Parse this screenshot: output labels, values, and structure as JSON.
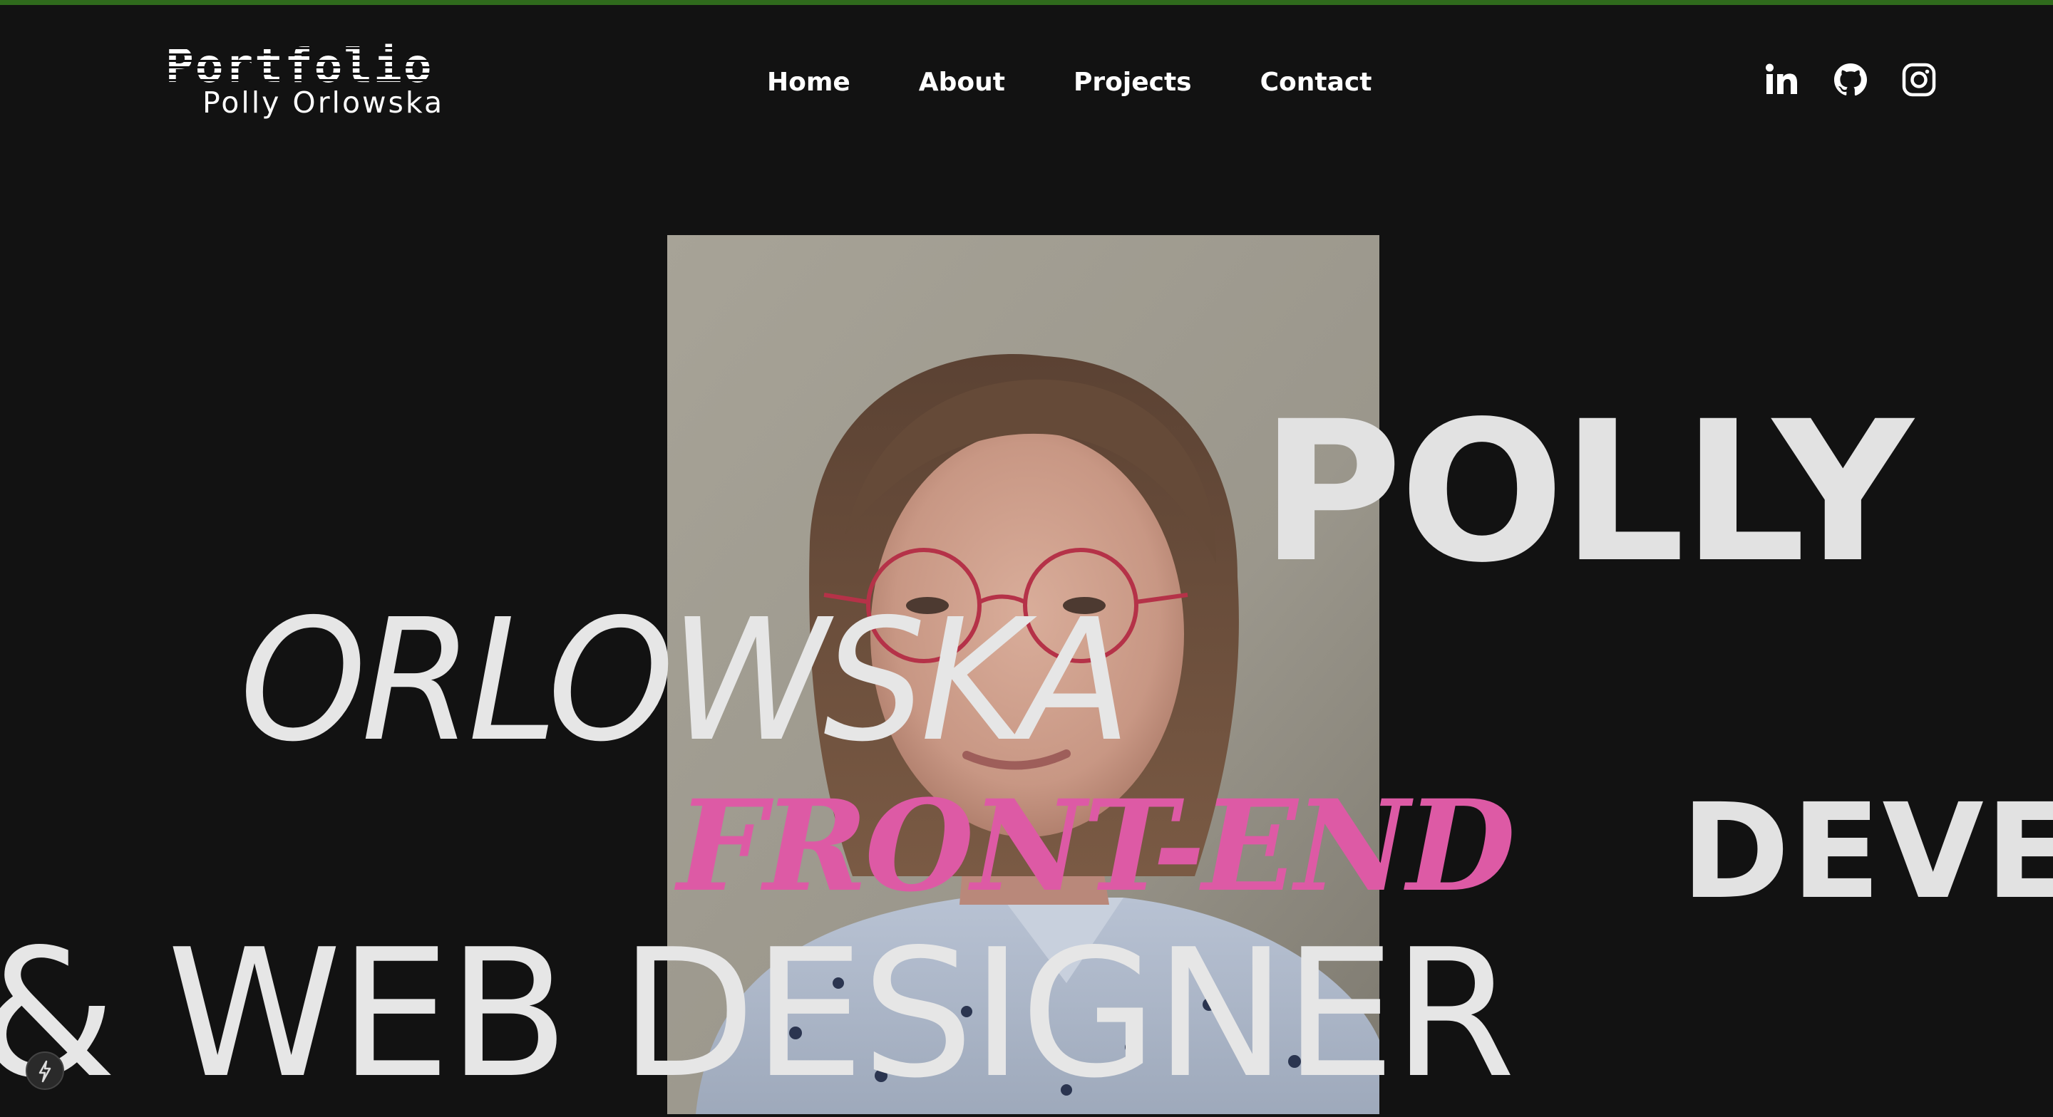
{
  "header": {
    "logo_title": "Portfolio",
    "logo_subtitle": "Polly Orlowska",
    "nav": [
      {
        "label": "Home"
      },
      {
        "label": "About"
      },
      {
        "label": "Projects"
      },
      {
        "label": "Contact"
      }
    ],
    "social": [
      {
        "icon": "linkedin-icon"
      },
      {
        "icon": "github-icon"
      },
      {
        "icon": "instagram-icon"
      }
    ]
  },
  "hero": {
    "first_name": "POLLY",
    "last_name": "ORLOWSKA",
    "role_highlight": "FRONT-END",
    "role_rest": "DEVE",
    "role_line2": "& WEB DESIGNER"
  },
  "colors": {
    "background": "#121212",
    "text": "#e2e2e2",
    "accent_pink": "#dd5aa5",
    "top_line": "#2f6a1c"
  }
}
